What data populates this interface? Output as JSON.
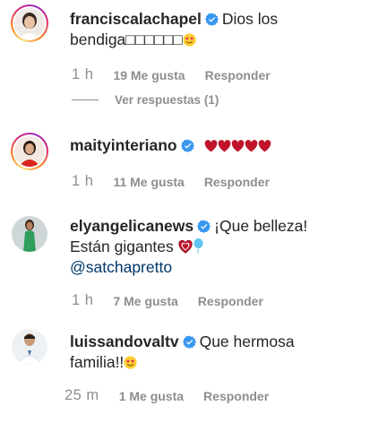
{
  "comments": [
    {
      "username": "francis­calachapel",
      "text_line1": "Dios los",
      "text_line2": "bendiga□□□□□□",
      "time": "1 h",
      "likes": "19 Me gusta",
      "reply": "Responder",
      "view_replies": "Ver respuestas (1)",
      "avatar_ring": true
    },
    {
      "username": "maityinteriano",
      "text_line1": "",
      "hearts": 5,
      "time": "1 h",
      "likes": "11 Me gusta",
      "reply": "Responder",
      "avatar_ring": true
    },
    {
      "username": "elyangelicanews",
      "text_line1": "¡Que belleza!",
      "text_line2": "Están gigantes",
      "mention": "@satchapretto",
      "time": "1 h",
      "likes": "7 Me gusta",
      "reply": "Responder",
      "avatar_ring": false
    },
    {
      "username": "luissandovaltv",
      "text_line1": "Que hermosa",
      "text_line2": "familia!!",
      "time": "25 m",
      "likes": "1 Me gusta",
      "reply": "Responder",
      "avatar_ring": false
    }
  ],
  "colors": {
    "verified": "#3897f0",
    "heart": "#c0142b",
    "meta": "#8e8e8e",
    "mention": "#00376b"
  },
  "icons": [
    "verified-badge-icon",
    "red-heart-icon",
    "smiling-heart-eyes-icon",
    "light-blue-balloon-icon"
  ]
}
